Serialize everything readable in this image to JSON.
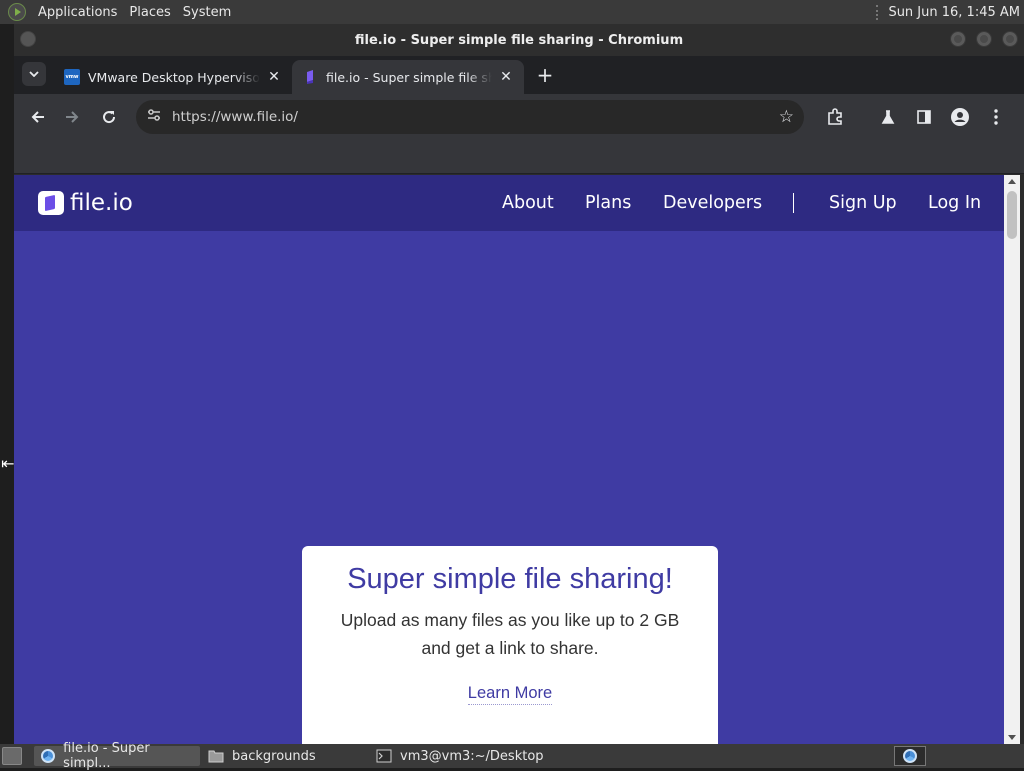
{
  "top_panel": {
    "menus": [
      "Applications",
      "Places",
      "System"
    ],
    "clock": "Sun Jun 16,  1:45 AM"
  },
  "window": {
    "title": "file.io - Super simple file sharing - Chromium"
  },
  "tabs": [
    {
      "title": "VMware Desktop Hypervisor",
      "favicon": "vmware-icon",
      "active": false
    },
    {
      "title": "file.io - Super simple file sharing",
      "favicon": "fileio-icon",
      "active": true
    }
  ],
  "toolbar": {
    "url": "https://www.file.io/"
  },
  "site": {
    "logo_text": "file.io",
    "nav": {
      "about": "About",
      "plans": "Plans",
      "developers": "Developers",
      "signup": "Sign Up",
      "login": "Log In"
    },
    "hero": {
      "title": "Super simple file sharing!",
      "subtitle_line1": "Upload as many files as you like up to 2 GB",
      "subtitle_line2": "and get a link to share.",
      "learn_more": "Learn More"
    },
    "colors": {
      "header_bg": "#2e2a82",
      "page_bg": "#3f3ba3",
      "accent": "#3f3ba3"
    }
  },
  "taskbar": {
    "tasks": [
      {
        "label": "file.io - Super simpl...",
        "icon": "chromium-icon",
        "active": true
      },
      {
        "label": "backgrounds",
        "icon": "folder-icon",
        "active": false
      },
      {
        "label": "vm3@vm3:~/Desktop",
        "icon": "terminal-icon",
        "active": false
      }
    ]
  }
}
